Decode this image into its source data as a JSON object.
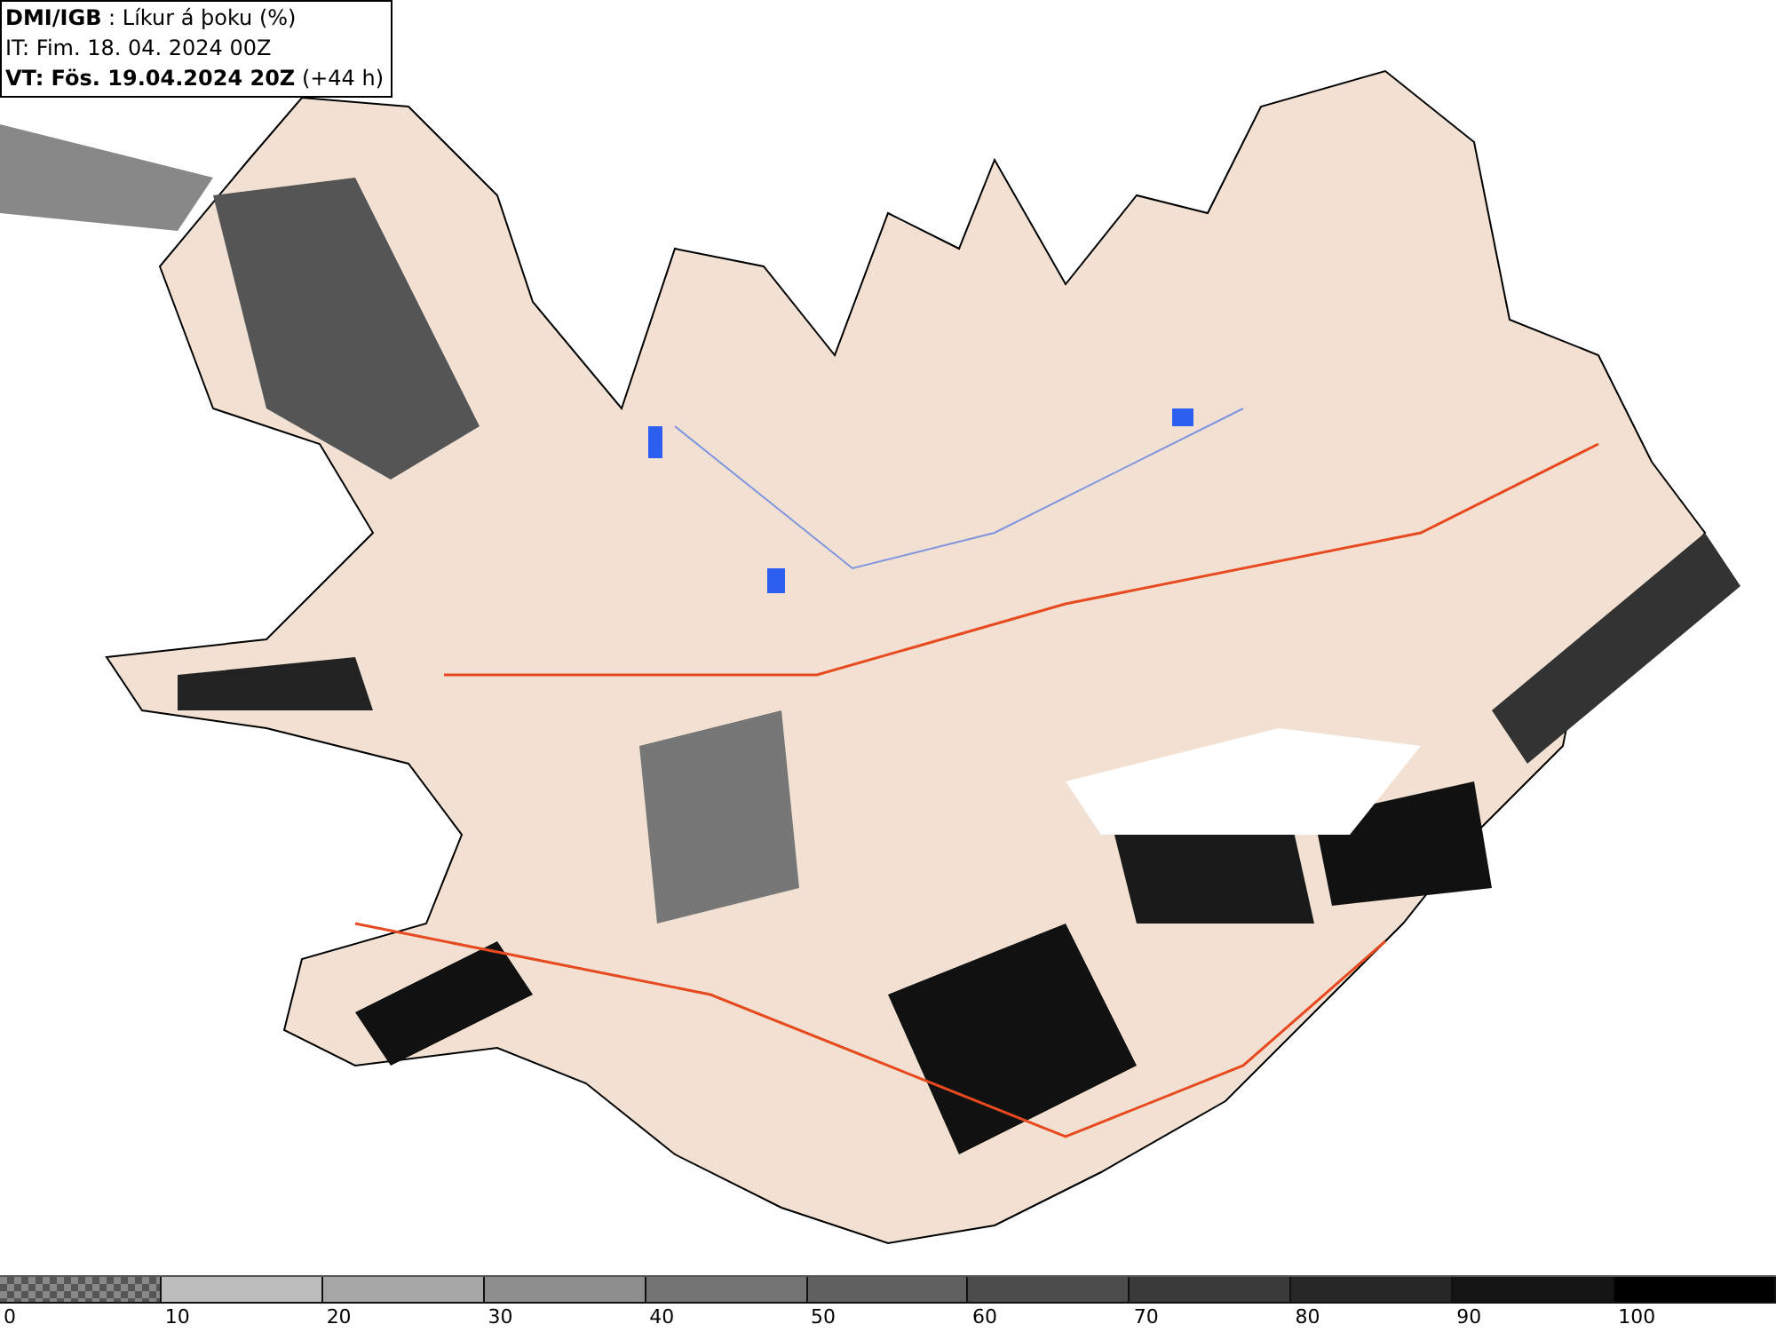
{
  "header": {
    "lines": [
      "**DMI/IGB** : Líkur á þoku (%)",
      "IT: Fim. 18. 04. 2024 00Z",
      "**VT: Fös. 19.04.2024 20Z** (+44 h)"
    ]
  },
  "legend": {
    "swatches": [
      {
        "kind": "checker",
        "label": "0"
      },
      {
        "kind": "solid",
        "color": "#bdbdbd",
        "label": "10"
      },
      {
        "kind": "solid",
        "color": "#a6a6a6",
        "label": "20"
      },
      {
        "kind": "solid",
        "color": "#8e8e8e",
        "label": "30"
      },
      {
        "kind": "solid",
        "color": "#747474",
        "label": "40"
      },
      {
        "kind": "solid",
        "color": "#606060",
        "label": "50"
      },
      {
        "kind": "solid",
        "color": "#4c4c4c",
        "label": "60"
      },
      {
        "kind": "solid",
        "color": "#3a3a3a",
        "label": "70"
      },
      {
        "kind": "solid",
        "color": "#262626",
        "label": "80"
      },
      {
        "kind": "solid",
        "color": "#141414",
        "label": "90"
      },
      {
        "kind": "solid",
        "color": "#000000",
        "label": "100"
      }
    ]
  }
}
